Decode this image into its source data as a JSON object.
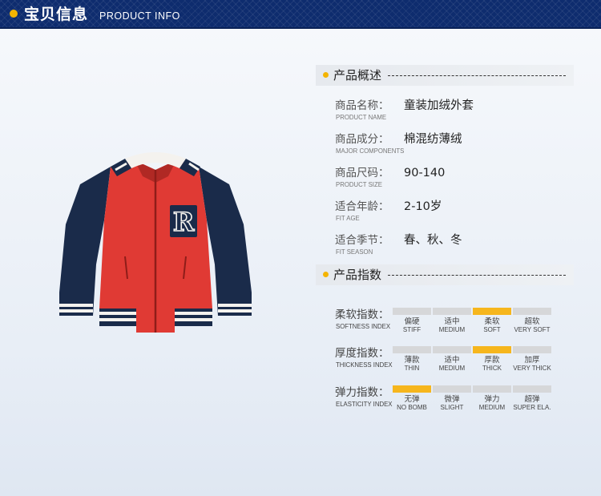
{
  "header": {
    "title": "宝贝信息",
    "subtitle": "PRODUCT INFO"
  },
  "colors": {
    "header_bg": "#0e2c6e",
    "accent": "#f4b400",
    "index_active": "#f6b61d",
    "index_inactive": "#d6d7d9",
    "jacket_body": "#e03a34",
    "jacket_sleeve": "#1a2b4a"
  },
  "overview": {
    "title": "产品概述",
    "rows": [
      {
        "label_cn": "商品名称：",
        "label_en": "PRODUCT NAME",
        "value": "童装加绒外套"
      },
      {
        "label_cn": "商品成分：",
        "label_en": "MAJOR COMPONENTS",
        "value": "棉混纺薄绒"
      },
      {
        "label_cn": "商品尺码：",
        "label_en": "PRODUCT SIZE",
        "value": "90-140"
      },
      {
        "label_cn": "适合年龄：",
        "label_en": "FIT AGE",
        "value": "2-10岁"
      },
      {
        "label_cn": "适合季节：",
        "label_en": "FIT SEASON",
        "value": "春、秋、冬"
      }
    ]
  },
  "indices": {
    "title": "产品指数",
    "rows": [
      {
        "label_cn": "柔软指数：",
        "label_en": "SOFTNESS INDEX",
        "selected_index": 2,
        "levels": [
          {
            "cn": "偏硬",
            "en": "STIFF"
          },
          {
            "cn": "适中",
            "en": "MEDIUM"
          },
          {
            "cn": "柔软",
            "en": "SOFT"
          },
          {
            "cn": "超软",
            "en": "VERY SOFT"
          }
        ]
      },
      {
        "label_cn": "厚度指数：",
        "label_en": "THICKNESS INDEX",
        "selected_index": 2,
        "levels": [
          {
            "cn": "薄款",
            "en": "THIN"
          },
          {
            "cn": "适中",
            "en": "MEDIUM"
          },
          {
            "cn": "厚款",
            "en": "THICK"
          },
          {
            "cn": "加厚",
            "en": "VERY THICK"
          }
        ]
      },
      {
        "label_cn": "弹力指数：",
        "label_en": "ELASTICITY INDEX",
        "selected_index": 0,
        "levels": [
          {
            "cn": "无弹",
            "en": "NO BOMB"
          },
          {
            "cn": "微弹",
            "en": "SLIGHT"
          },
          {
            "cn": "弹力",
            "en": "MEDIUM"
          },
          {
            "cn": "超弹",
            "en": "SUPER ELA."
          }
        ]
      }
    ]
  },
  "jacket": {
    "patch_letter": "R"
  }
}
